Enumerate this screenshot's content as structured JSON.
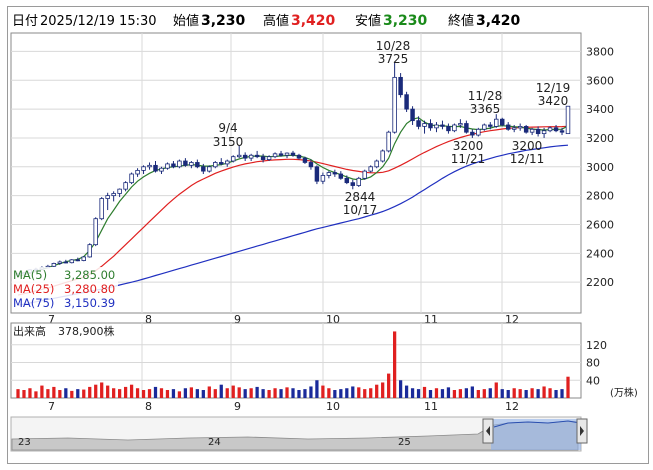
{
  "header": {
    "date_label": "日付",
    "datetime": "2025/12/19 15:30",
    "open_label": "始値",
    "open": "3,230",
    "high_label": "高値",
    "high": "3,420",
    "low_label": "安値",
    "low": "3,230",
    "close_label": "終値",
    "close": "3,420"
  },
  "colors": {
    "up": "#ffffff",
    "down": "#1a2a7a",
    "ma5": "#2e7d2e",
    "ma25": "#e02020",
    "ma75": "#2030c0",
    "high": "#e02020",
    "low": "#1a8a1a",
    "volume_up": "#e02020",
    "volume_down": "#1a2a9a"
  },
  "legend": {
    "ma5_label": "MA(5)",
    "ma5_value": "3,285.00",
    "ma25_label": "MA(25)",
    "ma25_value": "3,280.80",
    "ma75_label": "MA(75)",
    "ma75_value": "3,150.39"
  },
  "volume_panel": {
    "label": "出来高",
    "value": "378,900株",
    "unit": "(万株)"
  },
  "annotations": {
    "a1_date": "9/4",
    "a1_val": "3150",
    "a2_date": "10/28",
    "a2_val": "3725",
    "a3_val": "2844",
    "a3_date": "10/17",
    "a4_date": "11/28",
    "a4_val": "3365",
    "a5_val": "3200",
    "a5_date": "11/21",
    "a6_val": "3200",
    "a6_date": "12/11",
    "a7_date": "12/19",
    "a7_val": "3420"
  },
  "navigator": {
    "labels": [
      "23",
      "24",
      "25"
    ]
  },
  "chart_data": [
    {
      "type": "candlestick",
      "title": "",
      "ylim": [
        2000,
        3900
      ],
      "yticks": [
        "3800",
        "3600",
        "3400",
        "3200",
        "3000",
        "2800",
        "2600",
        "2400",
        "2200"
      ],
      "xlabels": [
        "7",
        "8",
        "9",
        "10",
        "11",
        "12"
      ],
      "ohlc": [
        [
          2250,
          2265,
          2245,
          2260
        ],
        [
          2260,
          2270,
          2255,
          2265
        ],
        [
          2265,
          2290,
          2260,
          2285
        ],
        [
          2285,
          2300,
          2275,
          2290
        ],
        [
          2290,
          2310,
          2285,
          2300
        ],
        [
          2300,
          2320,
          2295,
          2310
        ],
        [
          2310,
          2335,
          2305,
          2330
        ],
        [
          2330,
          2350,
          2320,
          2340
        ],
        [
          2340,
          2355,
          2330,
          2335
        ],
        [
          2335,
          2360,
          2330,
          2355
        ],
        [
          2355,
          2370,
          2345,
          2350
        ],
        [
          2350,
          2380,
          2345,
          2375
        ],
        [
          2375,
          2470,
          2370,
          2460
        ],
        [
          2460,
          2650,
          2450,
          2640
        ],
        [
          2640,
          2790,
          2630,
          2780
        ],
        [
          2780,
          2820,
          2700,
          2800
        ],
        [
          2800,
          2830,
          2760,
          2815
        ],
        [
          2815,
          2850,
          2790,
          2845
        ],
        [
          2845,
          2900,
          2830,
          2890
        ],
        [
          2890,
          2960,
          2880,
          2950
        ],
        [
          2950,
          2990,
          2930,
          2975
        ],
        [
          2975,
          3010,
          2950,
          3000
        ],
        [
          3000,
          3030,
          2980,
          3010
        ],
        [
          3010,
          3040,
          2960,
          2970
        ],
        [
          2970,
          3000,
          2950,
          2990
        ],
        [
          2990,
          3030,
          2980,
          3020
        ],
        [
          3020,
          3040,
          2990,
          3000
        ],
        [
          3000,
          3050,
          2990,
          3040
        ],
        [
          3040,
          3060,
          3000,
          3010
        ],
        [
          3010,
          3040,
          2990,
          3030
        ],
        [
          3030,
          3050,
          2990,
          3000
        ],
        [
          3000,
          3020,
          2950,
          2970
        ],
        [
          2970,
          3010,
          2960,
          3000
        ],
        [
          3000,
          3040,
          2990,
          3030
        ],
        [
          3030,
          3060,
          3010,
          3020
        ],
        [
          3020,
          3050,
          3000,
          3040
        ],
        [
          3040,
          3080,
          3030,
          3070
        ],
        [
          3070,
          3150,
          3060,
          3080
        ],
        [
          3080,
          3100,
          3040,
          3060
        ],
        [
          3060,
          3090,
          3040,
          3080
        ],
        [
          3080,
          3110,
          3060,
          3070
        ],
        [
          3070,
          3090,
          3030,
          3050
        ],
        [
          3050,
          3080,
          3040,
          3070
        ],
        [
          3070,
          3100,
          3060,
          3090
        ],
        [
          3090,
          3110,
          3070,
          3080
        ],
        [
          3080,
          3100,
          3060,
          3095
        ],
        [
          3095,
          3110,
          3070,
          3080
        ],
        [
          3080,
          3090,
          3050,
          3060
        ],
        [
          3060,
          3070,
          3020,
          3030
        ],
        [
          3030,
          3050,
          2980,
          3000
        ],
        [
          3000,
          3010,
          2880,
          2900
        ],
        [
          2900,
          2960,
          2880,
          2940
        ],
        [
          2940,
          2970,
          2920,
          2960
        ],
        [
          2960,
          2980,
          2930,
          2950
        ],
        [
          2950,
          2970,
          2910,
          2920
        ],
        [
          2920,
          2940,
          2880,
          2890
        ],
        [
          2890,
          2910,
          2844,
          2870
        ],
        [
          2870,
          2930,
          2860,
          2920
        ],
        [
          2920,
          2980,
          2910,
          2970
        ],
        [
          2970,
          3010,
          2960,
          3000
        ],
        [
          3000,
          3050,
          2990,
          3040
        ],
        [
          3040,
          3120,
          3030,
          3110
        ],
        [
          3110,
          3250,
          3100,
          3240
        ],
        [
          3240,
          3725,
          3230,
          3620
        ],
        [
          3620,
          3650,
          3480,
          3500
        ],
        [
          3500,
          3520,
          3380,
          3400
        ],
        [
          3400,
          3420,
          3290,
          3320
        ],
        [
          3320,
          3350,
          3260,
          3280
        ],
        [
          3280,
          3320,
          3230,
          3300
        ],
        [
          3300,
          3330,
          3250,
          3270
        ],
        [
          3270,
          3310,
          3240,
          3290
        ],
        [
          3290,
          3320,
          3260,
          3280
        ],
        [
          3280,
          3300,
          3230,
          3250
        ],
        [
          3250,
          3300,
          3240,
          3290
        ],
        [
          3290,
          3330,
          3270,
          3300
        ],
        [
          3300,
          3320,
          3230,
          3240
        ],
        [
          3240,
          3260,
          3200,
          3220
        ],
        [
          3220,
          3270,
          3210,
          3260
        ],
        [
          3260,
          3300,
          3250,
          3290
        ],
        [
          3290,
          3310,
          3260,
          3280
        ],
        [
          3280,
          3365,
          3270,
          3330
        ],
        [
          3330,
          3340,
          3280,
          3290
        ],
        [
          3290,
          3310,
          3250,
          3260
        ],
        [
          3260,
          3290,
          3240,
          3270
        ],
        [
          3270,
          3300,
          3250,
          3280
        ],
        [
          3280,
          3290,
          3230,
          3240
        ],
        [
          3240,
          3270,
          3220,
          3260
        ],
        [
          3260,
          3280,
          3210,
          3230
        ],
        [
          3230,
          3270,
          3200,
          3250
        ],
        [
          3250,
          3280,
          3240,
          3270
        ],
        [
          3270,
          3290,
          3240,
          3250
        ],
        [
          3250,
          3270,
          3220,
          3240
        ],
        [
          3230,
          3420,
          3230,
          3420
        ]
      ],
      "ma5": [
        2240,
        2250,
        2262,
        2275,
        2288,
        2300,
        2315,
        2328,
        2342,
        2350,
        2358,
        2378,
        2420,
        2480,
        2560,
        2640,
        2700,
        2760,
        2810,
        2860,
        2900,
        2930,
        2955,
        2975,
        2985,
        2995,
        3000,
        3005,
        3010,
        3015,
        3012,
        3005,
        3005,
        3010,
        3015,
        3025,
        3040,
        3055,
        3065,
        3072,
        3075,
        3074,
        3070,
        3072,
        3075,
        3078,
        3080,
        3075,
        3065,
        3050,
        3020,
        2995,
        2975,
        2960,
        2945,
        2930,
        2915,
        2910,
        2915,
        2930,
        2960,
        3000,
        3060,
        3160,
        3240,
        3300,
        3330,
        3340,
        3310,
        3290,
        3285,
        3285,
        3280,
        3278,
        3280,
        3270,
        3262,
        3258,
        3262,
        3268,
        3280,
        3285,
        3282,
        3278,
        3275,
        3268,
        3262,
        3258,
        3255,
        3258,
        3260,
        3260,
        3285
      ],
      "ma25": [
        2110,
        2120,
        2130,
        2140,
        2150,
        2160,
        2172,
        2185,
        2198,
        2210,
        2222,
        2236,
        2255,
        2280,
        2310,
        2345,
        2380,
        2420,
        2460,
        2500,
        2540,
        2580,
        2620,
        2660,
        2700,
        2740,
        2775,
        2810,
        2840,
        2870,
        2895,
        2915,
        2935,
        2955,
        2970,
        2985,
        2998,
        3010,
        3020,
        3028,
        3035,
        3040,
        3045,
        3048,
        3050,
        3052,
        3052,
        3050,
        3046,
        3040,
        3032,
        3022,
        3012,
        3002,
        2992,
        2982,
        2974,
        2968,
        2962,
        2958,
        2958,
        2962,
        2972,
        2990,
        3010,
        3032,
        3055,
        3078,
        3100,
        3120,
        3140,
        3158,
        3175,
        3190,
        3203,
        3215,
        3225,
        3235,
        3243,
        3250,
        3256,
        3262,
        3267,
        3270,
        3272,
        3274,
        3275,
        3276,
        3277,
        3278,
        3278,
        3279,
        3281
      ],
      "ma75": [
        2040,
        2048,
        2056,
        2064,
        2072,
        2080,
        2088,
        2096,
        2104,
        2112,
        2120,
        2128,
        2136,
        2144,
        2152,
        2160,
        2170,
        2180,
        2190,
        2200,
        2210,
        2222,
        2234,
        2246,
        2258,
        2270,
        2282,
        2294,
        2306,
        2318,
        2330,
        2342,
        2354,
        2366,
        2378,
        2390,
        2402,
        2414,
        2426,
        2438,
        2450,
        2462,
        2474,
        2486,
        2498,
        2510,
        2522,
        2534,
        2546,
        2558,
        2570,
        2580,
        2590,
        2600,
        2610,
        2620,
        2630,
        2640,
        2652,
        2664,
        2676,
        2690,
        2706,
        2724,
        2744,
        2766,
        2790,
        2816,
        2842,
        2868,
        2894,
        2920,
        2944,
        2966,
        2986,
        3004,
        3020,
        3034,
        3046,
        3058,
        3070,
        3080,
        3090,
        3098,
        3106,
        3114,
        3120,
        3126,
        3132,
        3138,
        3143,
        3147,
        3150
      ]
    },
    {
      "type": "bar",
      "title": "",
      "ylim": [
        0,
        160
      ],
      "yticks": [
        "120",
        "80",
        "40"
      ],
      "values": [
        20,
        18,
        22,
        15,
        28,
        20,
        25,
        18,
        22,
        16,
        20,
        19,
        25,
        30,
        35,
        28,
        22,
        20,
        25,
        30,
        22,
        18,
        20,
        25,
        22,
        18,
        20,
        15,
        22,
        24,
        20,
        18,
        26,
        20,
        30,
        22,
        28,
        24,
        20,
        22,
        25,
        20,
        18,
        22,
        20,
        24,
        22,
        18,
        20,
        26,
        40,
        28,
        22,
        18,
        20,
        22,
        26,
        24,
        20,
        22,
        30,
        35,
        55,
        150,
        40,
        28,
        22,
        20,
        25,
        18,
        22,
        20,
        24,
        18,
        20,
        22,
        26,
        18,
        20,
        22,
        35,
        20,
        18,
        22,
        20,
        18,
        22,
        20,
        26,
        22,
        18,
        20,
        48
      ],
      "up": [
        1,
        1,
        1,
        1,
        1,
        1,
        1,
        1,
        0,
        1,
        0,
        1,
        1,
        1,
        1,
        1,
        1,
        1,
        1,
        1,
        1,
        1,
        1,
        0,
        1,
        1,
        0,
        1,
        0,
        1,
        0,
        0,
        1,
        1,
        0,
        1,
        1,
        1,
        0,
        1,
        0,
        0,
        1,
        1,
        0,
        1,
        0,
        0,
        0,
        0,
        0,
        1,
        1,
        0,
        0,
        0,
        0,
        1,
        1,
        1,
        1,
        1,
        1,
        1,
        0,
        0,
        0,
        0,
        1,
        0,
        1,
        0,
        0,
        1,
        1,
        0,
        0,
        1,
        1,
        0,
        1,
        0,
        0,
        1,
        1,
        0,
        1,
        0,
        1,
        1,
        0,
        0,
        1
      ]
    }
  ]
}
